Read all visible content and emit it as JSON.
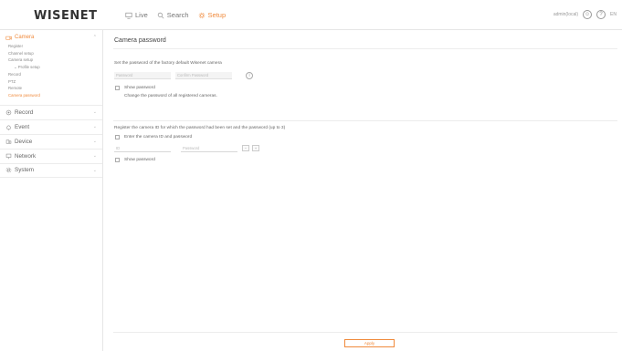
{
  "header": {
    "logo": "WISENET",
    "nav": [
      {
        "label": "Live",
        "icon": "monitor-icon"
      },
      {
        "label": "Search",
        "icon": "search-icon"
      },
      {
        "label": "Setup",
        "icon": "gear-icon"
      }
    ],
    "user_label": "admin(local)",
    "lang_label": "EN"
  },
  "sidebar": {
    "camera": {
      "label": "Camera",
      "items": [
        "Register",
        "Channel setup",
        "Camera setup",
        "Profile setup",
        "Record",
        "PTZ",
        "Remote",
        "Camera password"
      ]
    },
    "groups": [
      {
        "label": "Record",
        "icon": "record-icon"
      },
      {
        "label": "Event",
        "icon": "bell-icon"
      },
      {
        "label": "Device",
        "icon": "device-icon"
      },
      {
        "label": "Network",
        "icon": "network-icon"
      },
      {
        "label": "System",
        "icon": "system-icon"
      }
    ]
  },
  "main": {
    "title": "Camera password",
    "section1": {
      "text": "Set the password of the factory default Wisenet camera",
      "password_placeholder": "Password",
      "confirm_placeholder": "Confirm Password",
      "show_password": "Show password",
      "change_all": "Change the password of all registered cameras."
    },
    "section2": {
      "text": "Register the camera ID for which the password had been set and the password (up to 3)",
      "enter_id": "Enter the camera ID and password",
      "id_placeholder": "ID",
      "password_placeholder": "Password",
      "show_password": "Show password"
    },
    "apply": "Apply"
  },
  "colors": {
    "accent": "#f08a3c",
    "border": "#e6e6e6"
  }
}
